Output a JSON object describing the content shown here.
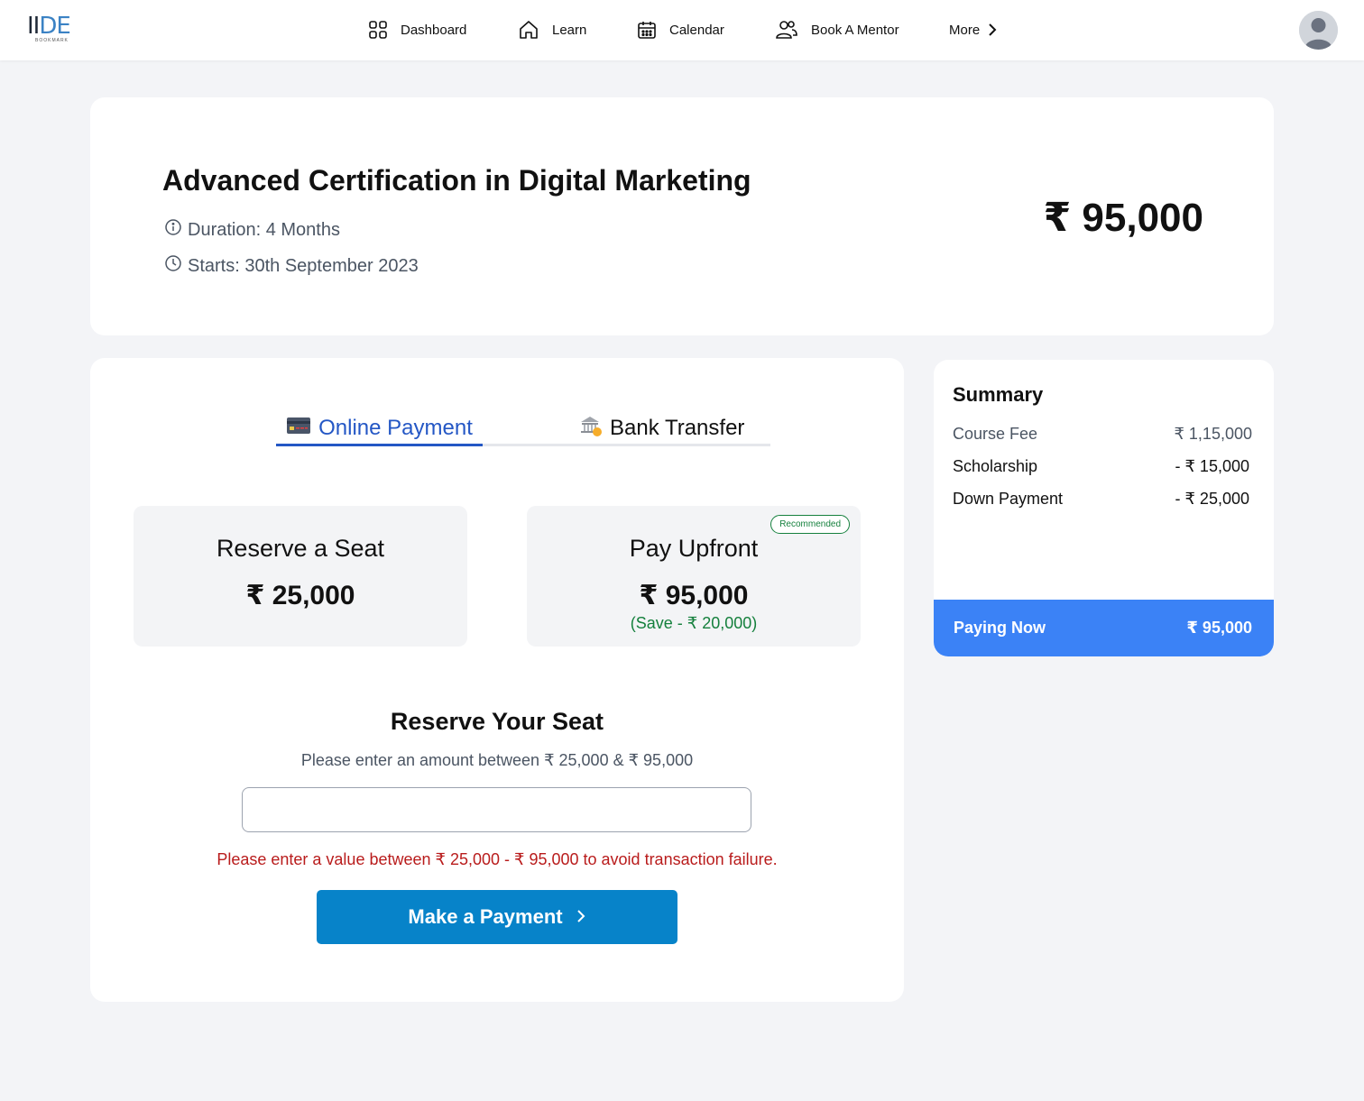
{
  "nav": {
    "logo_main_a": "II",
    "logo_main_b": "DE",
    "logo_sub": "BOOKMARK",
    "items": [
      {
        "label": "Dashboard",
        "icon": "grid-icon"
      },
      {
        "label": "Learn",
        "icon": "home-icon"
      },
      {
        "label": "Calendar",
        "icon": "calendar-icon"
      },
      {
        "label": "Book A Mentor",
        "icon": "users-icon"
      },
      {
        "label": "More",
        "icon": "chevron-right-icon"
      }
    ],
    "avatar_icon": "user-avatar-icon"
  },
  "course": {
    "title": "Advanced Certification in Digital Marketing",
    "duration": "Duration: 4 Months",
    "starts": "Starts: 30th September 2023",
    "price": "₹ 95,000"
  },
  "payment": {
    "tabs": [
      {
        "label": "Online Payment",
        "icon": "credit-card-icon",
        "active": true
      },
      {
        "label": "Bank Transfer",
        "icon": "bank-icon",
        "active": false
      }
    ],
    "options": {
      "reserve": {
        "title": "Reserve a Seat",
        "price": "₹ 25,000"
      },
      "upfront": {
        "title": "Pay Upfront",
        "price": "₹ 95,000",
        "save": "(Save - ₹ 20,000)",
        "badge": "Recommended"
      }
    },
    "reserve_title": "Reserve Your Seat",
    "hint": "Please enter an amount between ₹ 25,000 & ₹ 95,000",
    "input_value": "",
    "error": "Please enter a value between ₹ 25,000 - ₹ 95,000 to avoid transaction failure.",
    "button_label": "Make a Payment"
  },
  "summary": {
    "title": "Summary",
    "rows": [
      {
        "label": "Course Fee",
        "value": "₹ 1,15,000"
      },
      {
        "label": "Scholarship",
        "value": "- ₹ 15,000"
      },
      {
        "label": "Down Payment",
        "value": "- ₹ 25,000"
      }
    ],
    "paying_label": "Paying Now",
    "paying_value": "₹ 95,000"
  },
  "colors": {
    "accent_blue": "#2457c5",
    "button_blue": "#0783c9",
    "paying_bar": "#3b82f6",
    "success_green": "#15803d",
    "error_red": "#b91c1c",
    "page_bg": "#f3f4f7"
  }
}
